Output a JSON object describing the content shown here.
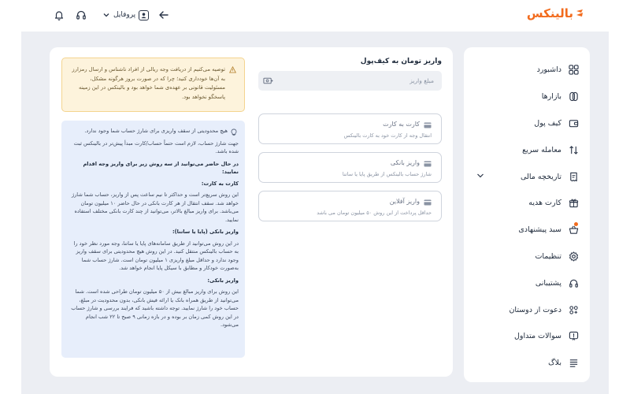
{
  "brand": {
    "logo_text": "بالینکس",
    "accent": "#f26b1d"
  },
  "topbar": {
    "profile_label": "پروفایل",
    "icons": [
      "arrow-left-icon",
      "chevron-down-icon",
      "user-icon",
      "headset-icon",
      "bell-icon"
    ]
  },
  "sidebar": {
    "items": [
      {
        "label": "داشبورد",
        "icon": "grid-icon"
      },
      {
        "label": "بازارها",
        "icon": "coins-icon"
      },
      {
        "label": "کیف پول",
        "icon": "wallet-icon"
      },
      {
        "label": "معامله سریع",
        "icon": "arrows-updown-icon"
      },
      {
        "label": "تاریخچه مالی",
        "icon": "receipt-icon",
        "expandable": true
      },
      {
        "label": "کارت هدیه",
        "icon": "gift-icon"
      },
      {
        "label": "سبد پیشنهادی",
        "icon": "basket-icon",
        "badge_color": "#f26b1d"
      },
      {
        "label": "تنظیمات",
        "icon": "gear-icon"
      },
      {
        "label": "پشتیبانی",
        "icon": "headset-icon"
      },
      {
        "label": "دعوت از دوستان",
        "icon": "users-icon"
      },
      {
        "label": "سوالات متداول",
        "icon": "question-icon"
      },
      {
        "label": "بلاگ",
        "icon": "menu-lines-icon"
      }
    ]
  },
  "deposit": {
    "title": "واریز تومان به کیف‌پول",
    "amount_placeholder": "مبلغ واریز",
    "methods": [
      {
        "title": "کارت به کارت",
        "desc": "انتقال وجه از کارت خود به کارت بالینکس"
      },
      {
        "title": "واریز بانکی",
        "desc": "شارژ حساب بالینکس از طریق پایا یا ساتنا"
      },
      {
        "title": "واریز آفلاین",
        "desc": "حداقل پرداخت از این روش ۵۰ میلیون تومان می باشد"
      }
    ]
  },
  "warning": {
    "text": "توصیه می‌کنیم از دریافت وجه ریالی از افراد ناشناس و ارسال رمزارز به آن‌ها خودداری کنید؛ چرا که در صورت بروز هرگونه مشکل، مسئولیت قانونی بر عهده‌ی شما خواهد بود و بالینکس در این زمینه پاسخگو نخواهد بود."
  },
  "info": {
    "p1": "هیچ محدودیتی از سقف واریزی برای شارژ حساب شما وجود ندارد.",
    "p2": "جهت شارژ حساب، لازم است حتماً حساب/کارت مبدأ پیش‌تر در بالینکس ثبت شده باشد.",
    "p3": "در حال حاضر می‌توانید از سه روش زیر برای واریز وجه اقدام نمایید:",
    "h1": "کارت به کارت:",
    "t1": "این روش سریع‌تر است و حداکثر تا نیم ساعت پس از واریز، حساب شما شارژ خواهد شد. سقف انتقال از هر کارت بانکی در حال حاضر ۱۰ میلیون تومان می‌باشد. برای واریز مبالغ بالاتر، می‌توانید از چند کارت بانکی مختلف استفاده نمایید.",
    "h2": "واریز بانکی (پایا یا ساتنا):",
    "t2": "در این روش می‌توانید از طریق سامانه‌های پایا یا ساتنا، وجه مورد نظر خود را به حساب بالینکس منتقل کنید. در این روش هیچ محدودیتی برای سقف واریز وجود ندارد و حداقل مبلغ واریزی ۱ میلیون تومان است. شارژ حساب شما به‌صورت خودکار و مطابق با سیکل پایا انجام خواهد شد.",
    "h3": "واریز بانکی:",
    "t3": "این روش برای واریز مبالغ بیش از ۵۰ میلیون تومان طراحی شده است. شما می‌توانید از طریق همراه بانک یا ارائه فیش بانکی، بدون محدودیت در مبلغ، حساب خود را شارژ نمایید. توجه داشته باشید که فرایند بررسی و شارژ حساب در این روش کمی زمان بر بوده و در بازه زمانی ۹ صبح تا ۲۲ شب انجام می‌شود."
  }
}
